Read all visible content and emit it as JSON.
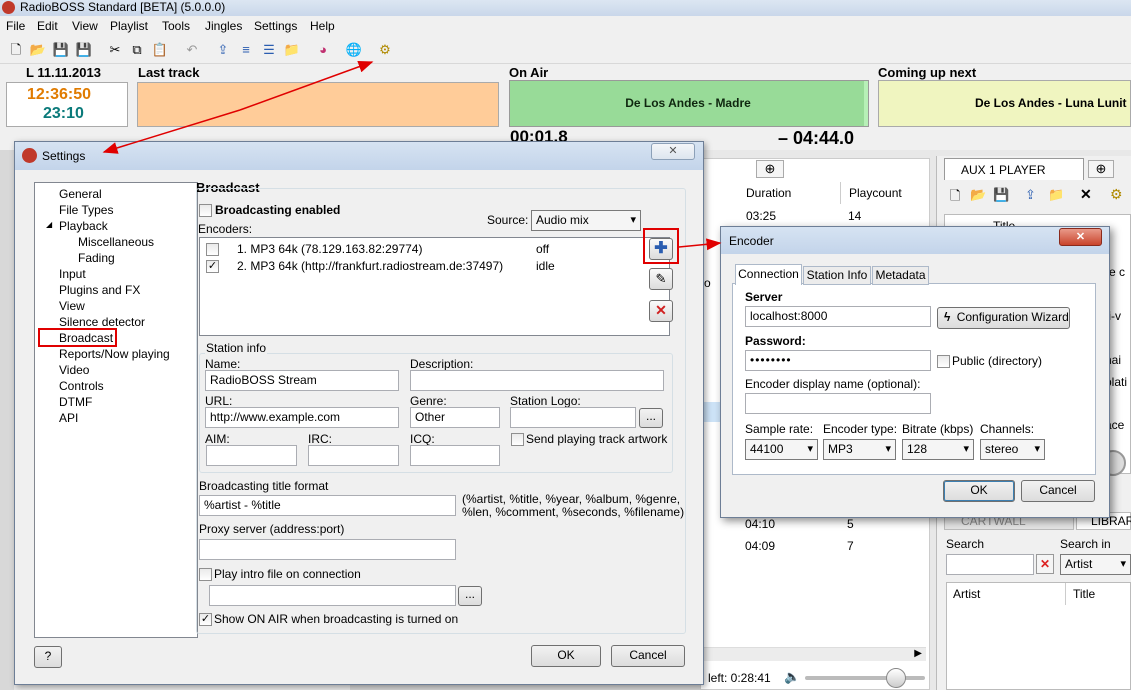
{
  "app": {
    "title": "RadioBOSS Standard [BETA] (5.0.0.0)",
    "menu": [
      "File",
      "Edit",
      "View",
      "Playlist",
      "Tools",
      "Jingles",
      "Settings",
      "Help"
    ]
  },
  "status": {
    "date": "L 11.11.2013",
    "time": "12:36:50",
    "time2": "23:10",
    "last_track_label": "Last track",
    "on_air_label": "On Air",
    "on_air_track": "De Los Andes - Madre",
    "on_air_elapsed": "00:01.8",
    "on_air_remaining": "– 04:44.0",
    "coming_label": "Coming up next",
    "coming_track": "De Los Andes - Luna Lunit",
    "progress": 0.99
  },
  "playlist": {
    "columns": [
      "Duration",
      "Playcount"
    ],
    "rows": [
      {
        "duration": "03:25",
        "playcount": "14"
      },
      {
        "duration": "04:10",
        "playcount": "5"
      },
      {
        "duration": "04:09",
        "playcount": "7"
      }
    ],
    "fragment": "o",
    "time_left": "left: 0:28:41"
  },
  "aux": {
    "tab": "AUX 1 PLAYER",
    "col_title": "Title",
    "partials": [
      "re c",
      "fi-v",
      "nai",
      "plati",
      "ace I"
    ],
    "cartwall": "CARTWALL",
    "library": "LIBRAR",
    "search_label": "Search",
    "search_in_label": "Search in",
    "search_in_value": "Artist",
    "col_artist": "Artist",
    "col_title2": "Title"
  },
  "settings": {
    "title": "Settings",
    "tree": [
      "General",
      "File Types",
      "Playback",
      "Miscellaneous",
      "Fading",
      "Input",
      "Plugins and FX",
      "View",
      "Silence detector",
      "Broadcast",
      "Reports/Now playing",
      "Video",
      "Controls",
      "DTMF",
      "API"
    ],
    "heading": "Broadcast",
    "broadcasting_enabled": "Broadcasting enabled",
    "source_label": "Source:",
    "source_value": "Audio mix",
    "encoders_label": "Encoders:",
    "encoders": [
      {
        "name": "1. MP3 64k (78.129.163.82:29774)",
        "state": "off",
        "checked": false
      },
      {
        "name": "2. MP3 64k (http://frankfurt.radiostream.de:37497)",
        "state": "idle",
        "checked": true
      }
    ],
    "station_info_label": "Station info",
    "name_label": "Name:",
    "name_value": "RadioBOSS Stream",
    "description_label": "Description:",
    "description_value": "",
    "url_label": "URL:",
    "url_value": "http://www.example.com",
    "genre_label": "Genre:",
    "genre_value": "Other",
    "logo_label": "Station Logo:",
    "browse": "...",
    "aim_label": "AIM:",
    "irc_label": "IRC:",
    "icq_label": "ICQ:",
    "send_artwork": "Send playing track artwork",
    "title_format_label": "Broadcasting title format",
    "title_format_value": "%artist - %title",
    "title_format_help1": "(%artist, %title, %year, %album, %genre,",
    "title_format_help2": "%len, %comment, %seconds, %filename)",
    "proxy_label": "Proxy server (address:port)",
    "proxy_value": "",
    "play_intro": "Play intro file on connection",
    "show_on_air": "Show ON AIR when broadcasting is turned on",
    "help": "?",
    "ok": "OK",
    "cancel": "Cancel"
  },
  "encoder": {
    "title": "Encoder",
    "tabs": [
      "Connection",
      "Station Info",
      "Metadata"
    ],
    "server_label": "Server",
    "server_value": "localhost:8000",
    "wizard": "Configuration Wizard",
    "password_label": "Password:",
    "password_value": "••••••••",
    "public": "Public (directory)",
    "display_name_label": "Encoder display name (optional):",
    "display_name_value": "",
    "sample_rate_label": "Sample rate:",
    "sample_rate_value": "44100",
    "encoder_type_label": "Encoder type:",
    "encoder_type_value": "MP3",
    "bitrate_label": "Bitrate (kbps)",
    "bitrate_value": "128",
    "channels_label": "Channels:",
    "channels_value": "stereo",
    "ok": "OK",
    "cancel": "Cancel"
  },
  "colors": {
    "time_orange": "#e07b00",
    "time_teal": "#0a7a7a",
    "last_track_bg": "#ffcc99",
    "on_air_bg": "#b7f0b7",
    "coming_bg": "#f0f5c0",
    "annotation_red": "#e00000"
  }
}
